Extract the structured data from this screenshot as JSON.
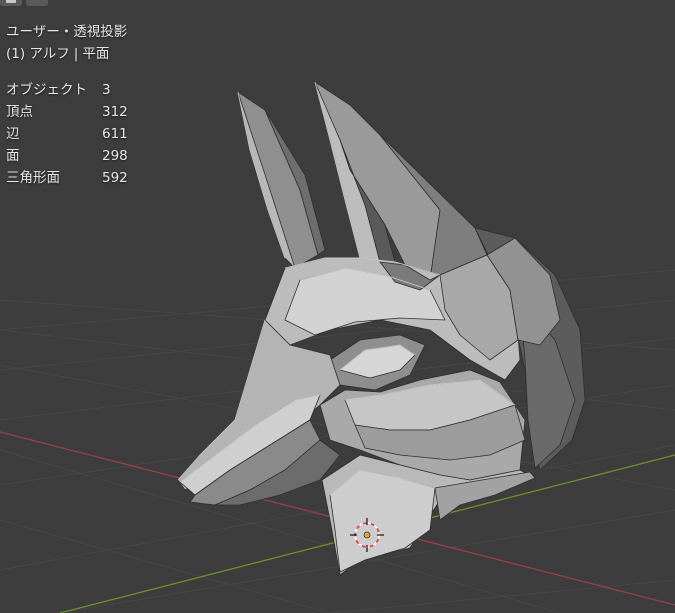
{
  "viewport": {
    "view_name": "ユーザー・透視投影",
    "object_info": "(1) アルフ",
    "mode": "平面",
    "separator": "|"
  },
  "stats": [
    {
      "label": "オブジェクト",
      "value": "3"
    },
    {
      "label": "頂点",
      "value": "312"
    },
    {
      "label": "辺",
      "value": "611"
    },
    {
      "label": "面",
      "value": "298"
    },
    {
      "label": "三角形面",
      "value": "592"
    }
  ],
  "top_tabs": [
    {
      "icon": "editor-type-icon",
      "text": ""
    },
    {
      "icon": "dots-icon",
      "text": "⋯"
    }
  ],
  "colors": {
    "background": "#3d3d3d",
    "grid": "#474747",
    "x_axis": "#9a3f48",
    "y_axis": "#6e8f2a",
    "mesh_light": "#c9c9c9",
    "mesh_mid": "#9e9e9e",
    "mesh_dark": "#5c5c5c",
    "cursor_red": "#e33b3b"
  }
}
